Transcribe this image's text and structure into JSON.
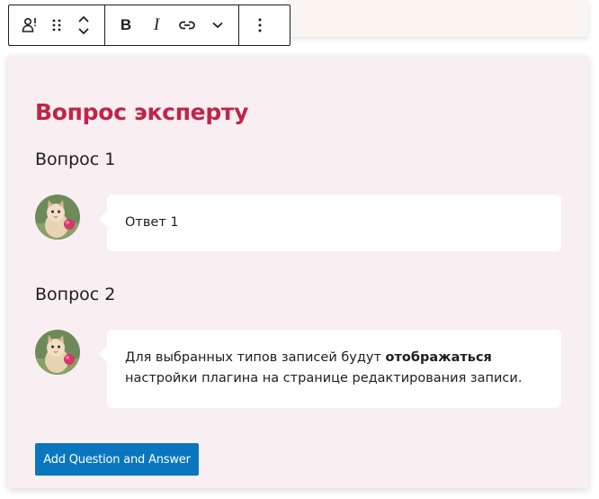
{
  "toolbar": {
    "items": [
      {
        "name": "block-type-icon",
        "label": "person-speech-icon"
      },
      {
        "name": "drag-handle-icon",
        "label": "drag-dots-icon"
      },
      {
        "name": "move-arrows-icon",
        "label": "chevron-up-down-icon"
      },
      {
        "name": "bold",
        "label": "B"
      },
      {
        "name": "italic",
        "label": "I"
      },
      {
        "name": "link-icon",
        "label": "link-icon"
      },
      {
        "name": "more-rich-text-icon",
        "label": "chevron-down-icon"
      },
      {
        "name": "options-icon",
        "label": "more-vertical-icon"
      }
    ],
    "bold_label": "B",
    "italic_label": "I"
  },
  "block": {
    "title": "Вопрос эксперту",
    "items": [
      {
        "question": "Вопрос 1",
        "answer": "Ответ 1"
      },
      {
        "question": "Вопрос 2",
        "answer_before": "Для выбранных типов записей будут ",
        "answer_bold": "отображаться",
        "answer_after": " настройки плагина на странице редактирования записи."
      }
    ],
    "add_button_label": "Add Question and Answer"
  },
  "colors": {
    "title": "#c0244a",
    "block_background": "#f9eef1",
    "button": "#0a76bf",
    "text": "#1e1e1e"
  }
}
